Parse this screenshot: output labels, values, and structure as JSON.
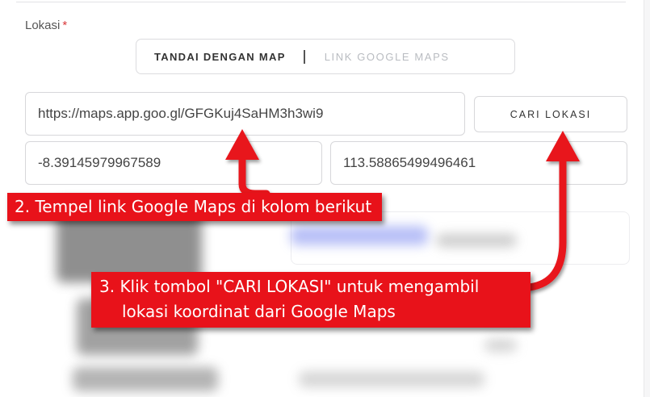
{
  "form": {
    "label": "Lokasi",
    "required_mark": "*",
    "mode_toggle": {
      "options": [
        {
          "label": "TANDAI DENGAN MAP",
          "active": true
        },
        {
          "label": "LINK GOOGLE MAPS",
          "active": false
        }
      ]
    },
    "url_value": "https://maps.app.goo.gl/GFGKuj4SaHM3h3wi9",
    "search_button": "CARI LOKASI",
    "latitude_value": "-8.39145979967589",
    "longitude_value": "113.58865499496461"
  },
  "annotations": {
    "step2": "2. Tempel link Google Maps di kolom berikut",
    "step3_line1": "3. Klik tombol \"CARI LOKASI\" untuk mengambil",
    "step3_line2": "lokasi koordinat dari Google Maps"
  },
  "colors": {
    "callout": "#e8121a",
    "required": "#d9383a",
    "inactive_text": "#b9bcc1"
  },
  "icons": [
    "arrow-up-icon"
  ]
}
